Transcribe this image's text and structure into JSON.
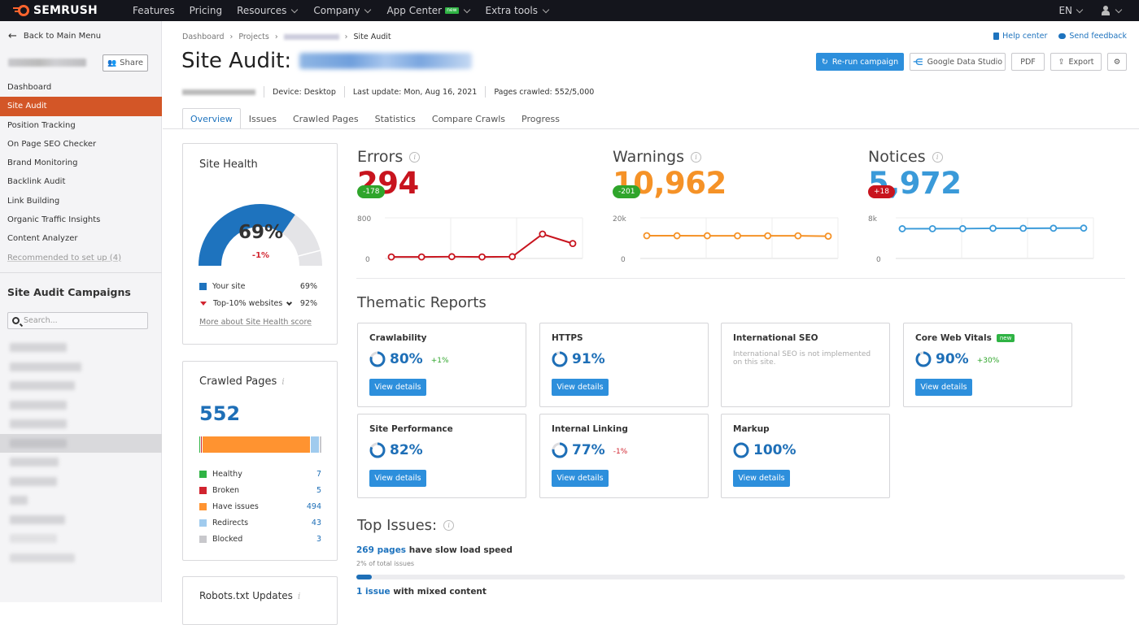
{
  "topbar": {
    "brand": "SEMRUSH",
    "nav": [
      {
        "label": "Features",
        "dropdown": false
      },
      {
        "label": "Pricing",
        "dropdown": false
      },
      {
        "label": "Resources",
        "dropdown": true
      },
      {
        "label": "Company",
        "dropdown": true
      },
      {
        "label": "App Center",
        "dropdown": true,
        "badge": "new"
      },
      {
        "label": "Extra tools",
        "dropdown": true
      }
    ],
    "language": "EN",
    "user_icon": "user-icon"
  },
  "sidebar": {
    "back_label": "Back to Main Menu",
    "share_label": "Share",
    "items": [
      {
        "label": "Dashboard",
        "active": false
      },
      {
        "label": "Site Audit",
        "active": true
      },
      {
        "label": "Position Tracking",
        "active": false
      },
      {
        "label": "On Page SEO Checker",
        "active": false
      },
      {
        "label": "Brand Monitoring",
        "active": false
      },
      {
        "label": "Backlink Audit",
        "active": false
      },
      {
        "label": "Link Building",
        "active": false
      },
      {
        "label": "Organic Traffic Insights",
        "active": false
      },
      {
        "label": "Content Analyzer",
        "active": false
      }
    ],
    "recommended_label": "Recommended to set up (4)",
    "campaigns_title": "Site Audit Campaigns",
    "search_placeholder": "Search..."
  },
  "header": {
    "breadcrumb": [
      "Dashboard",
      "Projects",
      "Site Audit"
    ],
    "title_prefix": "Site Audit:",
    "device": "Device: Desktop",
    "last_update": "Last update: Mon, Aug 16, 2021",
    "pages_crawled": "Pages crawled: 552/5,000",
    "help_center": "Help center",
    "send_feedback": "Send feedback",
    "actions": {
      "rerun": "Re-run campaign",
      "gds": "Google Data Studio",
      "pdf": "PDF",
      "export": "Export"
    },
    "tabs": [
      "Overview",
      "Issues",
      "Crawled Pages",
      "Statistics",
      "Compare Crawls",
      "Progress"
    ],
    "active_tab": "Overview"
  },
  "site_health": {
    "title": "Site Health",
    "value": "69%",
    "value_fraction": 0.69,
    "top10_fraction": 0.92,
    "delta": "-1%",
    "legend": [
      {
        "label": "Your site",
        "value": "69%"
      },
      {
        "label": "Top-10% websites",
        "value": "92%"
      }
    ],
    "more_link": "More about Site Health score",
    "colors": {
      "site": "#1e73be",
      "track": "#e4e4e7",
      "marker": "#d1242f"
    }
  },
  "crawled_pages": {
    "title": "Crawled Pages",
    "total": "552",
    "segments": [
      {
        "label": "Healthy",
        "value": 7,
        "color": "#2fb344"
      },
      {
        "label": "Broken",
        "value": 5,
        "color": "#d1242f"
      },
      {
        "label": "Have issues",
        "value": 494,
        "color": "#ff9330"
      },
      {
        "label": "Redirects",
        "value": 43,
        "color": "#a0cbee"
      },
      {
        "label": "Blocked",
        "value": 3,
        "color": "#c8c8cc"
      }
    ]
  },
  "robots": {
    "title": "Robots.txt Updates"
  },
  "metrics": [
    {
      "key": "errors",
      "label": "Errors",
      "value": "294",
      "delta": "-178",
      "delta_color": "#2fa52b",
      "color": "#c8141e",
      "ymax_label": "800",
      "ymin_label": "0",
      "ymax": 800,
      "series": [
        30,
        30,
        35,
        30,
        35,
        480,
        294
      ]
    },
    {
      "key": "warnings",
      "label": "Warnings",
      "value": "10,962",
      "delta": "-201",
      "delta_color": "#2fa52b",
      "color": "#f59227",
      "ymax_label": "20k",
      "ymin_label": "0",
      "ymax": 20000,
      "series": [
        11200,
        11180,
        11170,
        11160,
        11163,
        11160,
        10962
      ]
    },
    {
      "key": "notices",
      "label": "Notices",
      "value": "5,972",
      "delta": "+18",
      "delta_color": "#c8141e",
      "color": "#3a9ad9",
      "ymax_label": "8k",
      "ymin_label": "0",
      "ymax": 8000,
      "series": [
        5850,
        5860,
        5870,
        5930,
        5940,
        5954,
        5972
      ]
    }
  ],
  "thematic": {
    "title": "Thematic Reports",
    "view_details": "View details",
    "cards": [
      {
        "title": "Crawlability",
        "percent": "80%",
        "fraction": 0.8,
        "delta": "+1%",
        "delta_color": "#2fa52b"
      },
      {
        "title": "HTTPS",
        "percent": "91%",
        "fraction": 0.91,
        "delta": "",
        "delta_color": ""
      },
      {
        "title": "International SEO",
        "not_implemented": "International SEO is not implemented on this site."
      },
      {
        "title": "Core Web Vitals",
        "badge": "new",
        "percent": "90%",
        "fraction": 0.9,
        "delta": "+30%",
        "delta_color": "#2fa52b"
      },
      {
        "title": "Site Performance",
        "percent": "82%",
        "fraction": 0.82,
        "delta": "",
        "delta_color": ""
      },
      {
        "title": "Internal Linking",
        "percent": "77%",
        "fraction": 0.77,
        "delta": "-1%",
        "delta_color": "#d1242f"
      },
      {
        "title": "Markup",
        "percent": "100%",
        "fraction": 1.0,
        "delta": "",
        "delta_color": ""
      }
    ]
  },
  "top_issues": {
    "title": "Top Issues:",
    "items": [
      {
        "link": "269 pages",
        "text": " have slow load speed",
        "sub": "2% of total issues",
        "fraction": 0.02
      },
      {
        "link": "1 issue",
        "text": " with mixed content"
      }
    ]
  }
}
